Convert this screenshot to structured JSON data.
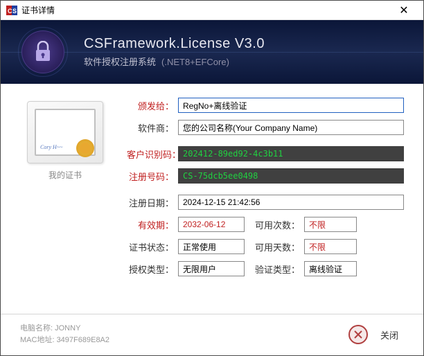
{
  "titlebar": {
    "title": "证书详情"
  },
  "header": {
    "title": "CSFramework.License V3.0",
    "subtitle": "软件授权注册系统",
    "tag": "(.NET8+EFCore)"
  },
  "cert": {
    "caption": "我的证书",
    "signature": "Cory H~~"
  },
  "labels": {
    "issued_to": "颁发给：",
    "vendor": "软件商：",
    "customer_id": "客户识别码：",
    "reg_no": "注册号码：",
    "reg_date": "注册日期：",
    "expiry": "有效期：",
    "usage_count": "可用次数：",
    "cert_status": "证书状态：",
    "usage_days": "可用天数：",
    "auth_type": "授权类型：",
    "verify_type": "验证类型："
  },
  "values": {
    "issued_to": "RegNo+离线验证",
    "vendor": "您的公司名称(Your Company Name)",
    "customer_id": "202412-89ed92-4c3b11",
    "reg_no": "CS-75dcb5ee0498",
    "reg_date": "2024-12-15 21:42:56",
    "expiry": "2032-06-12",
    "usage_count": "不限",
    "cert_status": "正常使用",
    "usage_days": "不限",
    "auth_type": "无限用户",
    "verify_type": "离线验证"
  },
  "footer": {
    "computer_label": "电脑名称:",
    "computer": "JONNY",
    "mac_label": "MAC地址:",
    "mac": "3497F689E8A2",
    "close": "关闭"
  }
}
